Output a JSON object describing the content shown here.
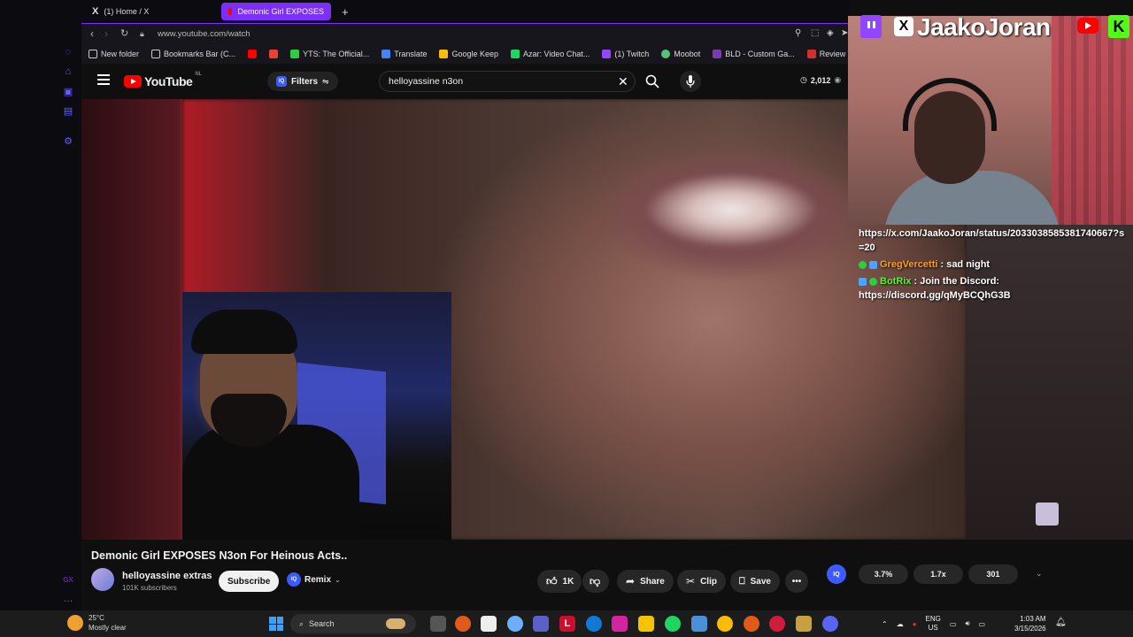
{
  "browser": {
    "tabs": [
      {
        "label": "(1) Home / X",
        "active": false
      },
      {
        "label": "Demonic Girl EXPOSES",
        "active": true
      }
    ],
    "url": "www.youtube.com/watch",
    "bookmarks": [
      "New folder",
      "Bookmarks Bar (C...",
      "YTS: The Official...",
      "Translate",
      "Google Keep",
      "Azar: Video Chat...",
      "(1) Twitch",
      "Moobot",
      "BLD - Custom Ga...",
      "Review Trip Deta"
    ]
  },
  "youtube": {
    "logo_text": "YouTube",
    "logo_region": "NL",
    "filters_label": "Filters",
    "search_value": "helloyassine n3on",
    "view_count": "2,012",
    "video_title": "Demonic Girl EXPOSES N3on For Heinous Acts..",
    "channel_name": "helloyassine extras",
    "subscribers": "101K subscribers",
    "subscribe_label": "Subscribe",
    "remix_label": "Remix",
    "likes": "1K",
    "share_label": "Share",
    "clip_label": "Clip",
    "save_label": "Save",
    "iq_badge": "IQ",
    "iq_stats": [
      "3.7%",
      "1.7x",
      "301"
    ]
  },
  "overlay": {
    "streamer_name": "JaakoJoran",
    "chat": [
      {
        "user": "",
        "text": "https://x.com/JaakoJoran/status/2033038585381740667?s=20"
      },
      {
        "user": "GregVercetti",
        "user_color": "#ff9f1a",
        "text": " : sad night"
      },
      {
        "user": "BotRix",
        "user_color": "#53fc18",
        "text": " : Join the Discord: https://discord.gg/qMyBCQhG3B"
      }
    ]
  },
  "taskbar": {
    "temperature": "25°C",
    "weather": "Mostly clear",
    "search_label": "Search",
    "lang": "ENG",
    "region": "US",
    "time": "1:03 AM",
    "date": "3/15/2026"
  }
}
